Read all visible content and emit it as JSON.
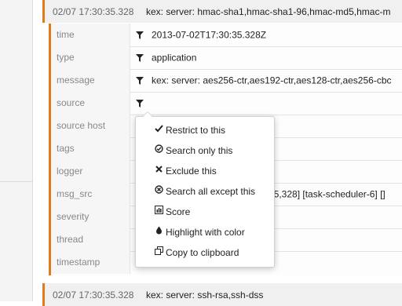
{
  "accent": "#e07b1a",
  "top_entry": {
    "timestamp": "02/07 17:30:35.328",
    "message": "kex: server: hmac-sha1,hmac-sha1-96,hmac-md5,hmac-m"
  },
  "fields": [
    {
      "key": "time",
      "value": "2013-07-02T17:30:35.328Z",
      "filter": true
    },
    {
      "key": "type",
      "value": "application",
      "filter": true
    },
    {
      "key": "message",
      "value": "kex: server: aes256-ctr,aes192-ctr,aes128-ctr,aes256-cbc",
      "filter": true
    },
    {
      "key": "source",
      "value": "",
      "filter": true
    },
    {
      "key": "source host",
      "value": "",
      "filter": false
    },
    {
      "key": "tags",
      "value": "",
      "filter": false
    },
    {
      "key": "logger",
      "value": "",
      "filter": false
    },
    {
      "key": "msg_src",
      "value": "35,328] [task-scheduler-6] []",
      "filter": false
    },
    {
      "key": "severity",
      "value": "",
      "filter": false
    },
    {
      "key": "thread",
      "value": "",
      "filter": false
    },
    {
      "key": "timestamp",
      "value": "",
      "filter": false
    }
  ],
  "context_menu": {
    "items": [
      {
        "label": "Restrict to this",
        "icon": "check-icon"
      },
      {
        "label": "Search only this",
        "icon": "circle-check-icon"
      },
      {
        "label": "Exclude this",
        "icon": "cross-icon"
      },
      {
        "label": "Search all except this",
        "icon": "circle-cross-icon"
      },
      {
        "label": "Score",
        "icon": "bar-chart-icon"
      },
      {
        "label": "Highlight with color",
        "icon": "drop-icon"
      },
      {
        "label": "Copy to clipboard",
        "icon": "clipboard-icon"
      }
    ]
  },
  "bottom_entry": {
    "timestamp": "02/07 17:30:35.328",
    "message": "kex: server: ssh-rsa,ssh-dss"
  }
}
